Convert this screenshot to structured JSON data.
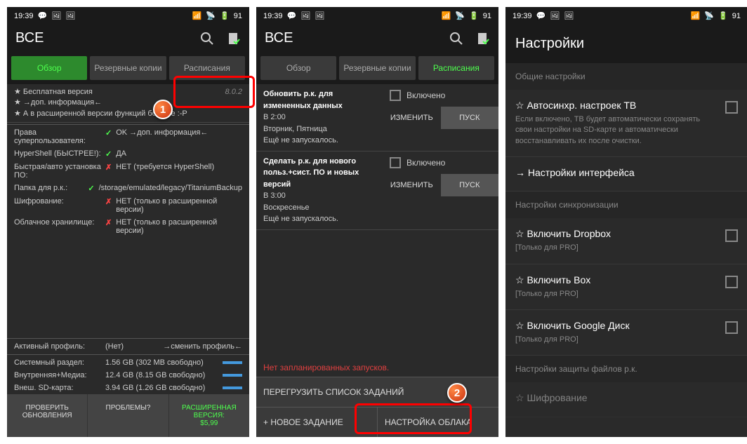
{
  "status": {
    "time": "19:39",
    "battery": "91"
  },
  "p1": {
    "title": "ВСЕ",
    "tabs": [
      "Обзор",
      "Резервные копии",
      "Расписания"
    ],
    "info": {
      "line1": "★ Бесплатная версия",
      "version": "8.0.2",
      "line2": "★ →доп. информация←",
      "line3": "★ А в расширенной версии функций больше :-P"
    },
    "rows": [
      {
        "label": "Права суперпользователя:",
        "status": "ok",
        "value": "OK →доп. информация←"
      },
      {
        "label": "HyperShell (БЫСТРЕЕ!):",
        "status": "ok",
        "value": "ДА"
      },
      {
        "label": "Быстрая/авто установка ПО:",
        "status": "no",
        "value": "НЕТ (требуется HyperShell)"
      },
      {
        "label": "Папка для р.к.:",
        "status": "ok",
        "value": "/storage/emulated/legacy/TitaniumBackup"
      },
      {
        "label": "Шифрование:",
        "status": "no",
        "value": "НЕТ (только в расширенной версии)"
      },
      {
        "label": "Облачное хранилище:",
        "status": "no",
        "value": "НЕТ (только в расширенной версии)"
      }
    ],
    "profile": {
      "label": "Активный профиль:",
      "value": "(Нет)",
      "action": "→сменить профиль←"
    },
    "storage": [
      {
        "label": "Системный раздел:",
        "value": "1.56 GB (302 MB свободно)"
      },
      {
        "label": "Внутренняя+Медиа:",
        "value": "12.4 GB (8.15 GB свободно)"
      },
      {
        "label": "Внеш. SD-карта:",
        "value": "3.94 GB (1.26 GB свободно)"
      }
    ],
    "bottom": {
      "check": "ПРОВЕРИТЬ ОБНОВЛЕНИЯ",
      "problems": "ПРОБЛЕМЫ?",
      "pro": "РАСШИРЕННАЯ ВЕРСИЯ:",
      "price": "$5,99"
    }
  },
  "p2": {
    "title": "ВСЕ",
    "tabs": [
      "Обзор",
      "Резервные копии",
      "Расписания"
    ],
    "schedules": [
      {
        "title": "Обновить р.к. для измененных данных",
        "time": "В 2:00",
        "days": "Вторник, Пятница",
        "last": "Ещё не запускалось.",
        "enabled": "Включено",
        "edit": "ИЗМЕНИТЬ",
        "run": "ПУСК"
      },
      {
        "title": "Сделать р.к. для нового польз.+сист. ПО и новых версий",
        "time": "В 3:00",
        "days": "Воскресенье",
        "last": "Ещё не запускалось.",
        "enabled": "Включено",
        "edit": "ИЗМЕНИТЬ",
        "run": "ПУСК"
      }
    ],
    "noRuns": "Нет запланированных запусков.",
    "reload": "ПЕРЕГРУЗИТЬ СПИСОК ЗАДАНИЙ",
    "newTask": "+ НОВОЕ ЗАДАНИЕ",
    "cloud": "НАСТРОЙКА ОБЛАКА"
  },
  "p3": {
    "title": "Настройки",
    "sec1": "Общие настройки",
    "items1": [
      {
        "title": "☆ Автосинхр. настроек ТВ",
        "desc": "Если включено, ТВ будет автоматически сохранять свои настройки на SD-карте и автоматически восстанавливать их после очистки.",
        "check": true
      },
      {
        "title": "→ Настройки интерфейса",
        "desc": "",
        "check": false
      }
    ],
    "sec2": "Настройки синхронизации",
    "items2": [
      {
        "title": "☆ Включить Dropbox",
        "desc": "[Только для PRO]"
      },
      {
        "title": "☆ Включить Box",
        "desc": "[Только для PRO]"
      },
      {
        "title": "☆ Включить Google Диск",
        "desc": "[Только для PRO]"
      }
    ],
    "sec3": "Настройки защиты файлов р.к.",
    "item3": "☆ Шифрование"
  }
}
